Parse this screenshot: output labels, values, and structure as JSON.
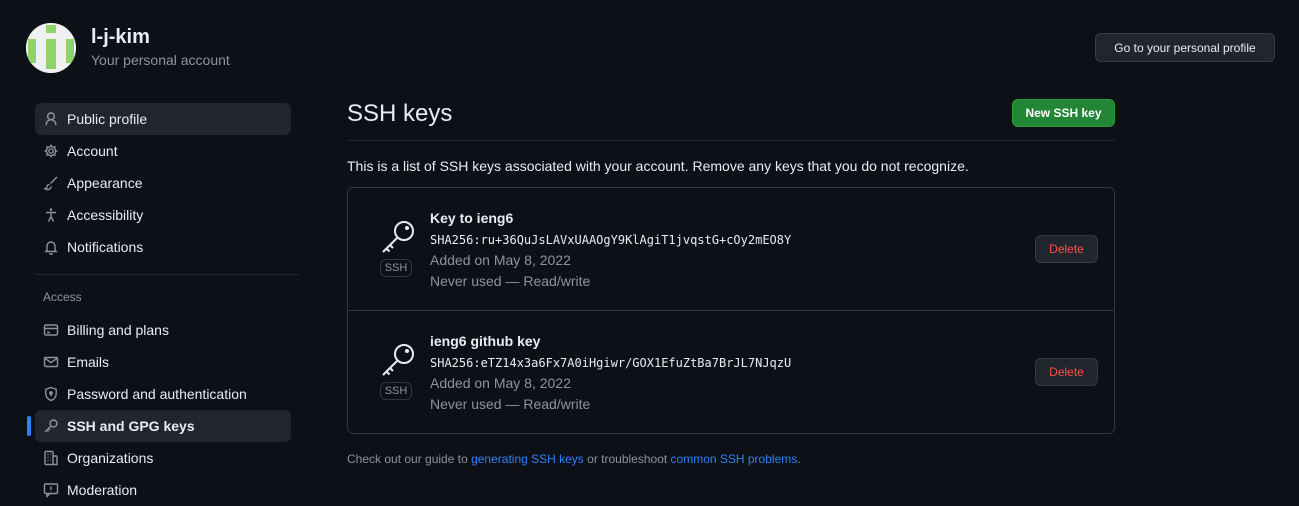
{
  "user": {
    "name": "l-j-kim",
    "subtitle": "Your personal account",
    "profile_button": "Go to your personal profile"
  },
  "sidebar": {
    "items": [
      {
        "label": "Public profile",
        "icon": "person-icon"
      },
      {
        "label": "Account",
        "icon": "gear-icon"
      },
      {
        "label": "Appearance",
        "icon": "paintbrush-icon"
      },
      {
        "label": "Accessibility",
        "icon": "accessibility-icon"
      },
      {
        "label": "Notifications",
        "icon": "bell-icon"
      }
    ],
    "access_heading": "Access",
    "access_items": [
      {
        "label": "Billing and plans",
        "icon": "credit-card-icon"
      },
      {
        "label": "Emails",
        "icon": "mail-icon"
      },
      {
        "label": "Password and authentication",
        "icon": "shield-lock-icon"
      },
      {
        "label": "SSH and GPG keys",
        "icon": "key-icon"
      },
      {
        "label": "Organizations",
        "icon": "organization-icon"
      },
      {
        "label": "Moderation",
        "icon": "report-icon"
      }
    ]
  },
  "main": {
    "title": "SSH keys",
    "new_key_button": "New SSH key",
    "intro": "This is a list of SSH keys associated with your account. Remove any keys that you do not recognize.",
    "keys": [
      {
        "title": "Key to ieng6",
        "fingerprint": "SHA256:ru+36QuJsLAVxUAAOgY9KlAgiT1jvqstG+cOy2mEO8Y",
        "added": "Added on May 8, 2022",
        "usage": "Never used — Read/write",
        "badge": "SSH",
        "delete_label": "Delete"
      },
      {
        "title": "ieng6 github key",
        "fingerprint": "SHA256:eTZ14x3a6Fx7A0iHgiwr/GOX1EfuZtBa7BrJL7NJqzU",
        "added": "Added on May 8, 2022",
        "usage": "Never used — Read/write",
        "badge": "SSH",
        "delete_label": "Delete"
      }
    ],
    "footer": {
      "prefix": "Check out our guide to ",
      "link1": "generating SSH keys",
      "middle": " or troubleshoot ",
      "link2": "common SSH problems",
      "suffix": "."
    }
  },
  "colors": {
    "background": "#0d1117",
    "accent_green": "#238636",
    "link_blue": "#2f81f7",
    "danger_red": "#f85149"
  }
}
